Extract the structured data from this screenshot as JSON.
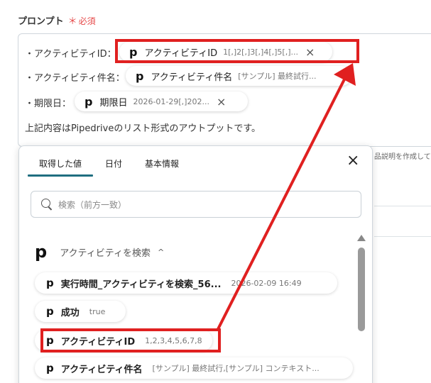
{
  "field": {
    "label": "プロンプト",
    "required_star": "＊",
    "required_text": "必須"
  },
  "prompt": {
    "lines": [
      {
        "prefix": "・アクティビティID：",
        "pill_label": "アクティビティID",
        "pill_value": "1[,]2[,]3[,]4[,]5[,]..."
      },
      {
        "prefix": "・アクティビティ件名：",
        "pill_label": "アクティビティ件名",
        "pill_value": "[サンプル] 最終試行..."
      },
      {
        "prefix": "・期限日：",
        "pill_label": "期限日",
        "pill_value": "2026-01-29[,]202..."
      }
    ],
    "sentence": "上記内容はPipedriveのリスト形式のアウトプットです。"
  },
  "aside_text": "品説明を作成して",
  "panel": {
    "tabs": [
      "取得した値",
      "日付",
      "基本情報"
    ],
    "search_placeholder": "検索（前方一致）",
    "group_title": "アクティビティを検索",
    "items": [
      {
        "label": "実行時間_アクティビティを検索_56...",
        "value": "2026-02-09 16:49"
      },
      {
        "label": "成功",
        "value": "true"
      },
      {
        "label": "アクティビティID",
        "value": "1,2,3,4,5,6,7,8"
      },
      {
        "label": "アクティビティ件名",
        "value": "[サンプル] 最終試行,[サンプル] コンテキスト..."
      }
    ]
  },
  "icons": {
    "logo": "p",
    "close": "×",
    "chevron_up": "^"
  },
  "colors": {
    "highlight": "#e02020",
    "accent": "#1f6e80",
    "required": "#e64a4a"
  }
}
